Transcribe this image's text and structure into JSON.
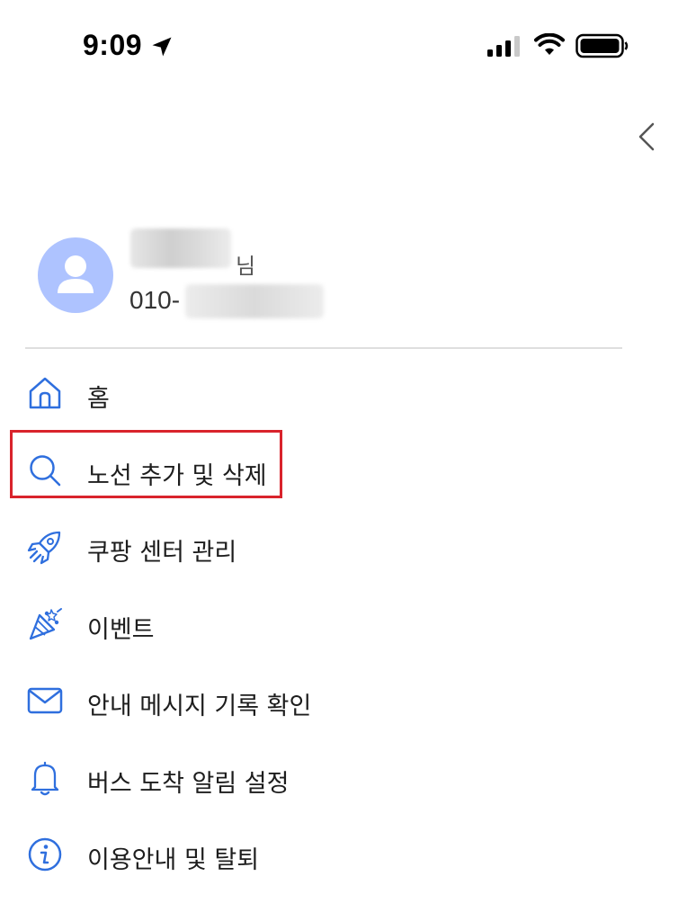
{
  "status_bar": {
    "time": "9:09",
    "icons": [
      "location-arrow-icon",
      "cellular-signal-icon",
      "wifi-icon",
      "battery-icon"
    ]
  },
  "header": {
    "close_icon": "chevron-left-icon"
  },
  "profile": {
    "avatar_icon": "person-icon",
    "avatar_color": "#aec3ff",
    "honorific": "님",
    "phone_prefix": "010-"
  },
  "menu": {
    "accent_color": "#2f6fde",
    "items": [
      {
        "label": "홈",
        "icon": "home-icon"
      },
      {
        "label": "노선 추가 및 삭제",
        "icon": "search-icon"
      },
      {
        "label": "쿠팡 센터 관리",
        "icon": "rocket-icon"
      },
      {
        "label": "이벤트",
        "icon": "party-popper-icon"
      },
      {
        "label": "안내 메시지 기록 확인",
        "icon": "mail-icon"
      },
      {
        "label": "버스 도착 알림 설정",
        "icon": "bell-icon"
      },
      {
        "label": "이용안내 및 탈퇴",
        "icon": "info-icon"
      }
    ]
  },
  "highlight": {
    "color": "#d9232c"
  }
}
